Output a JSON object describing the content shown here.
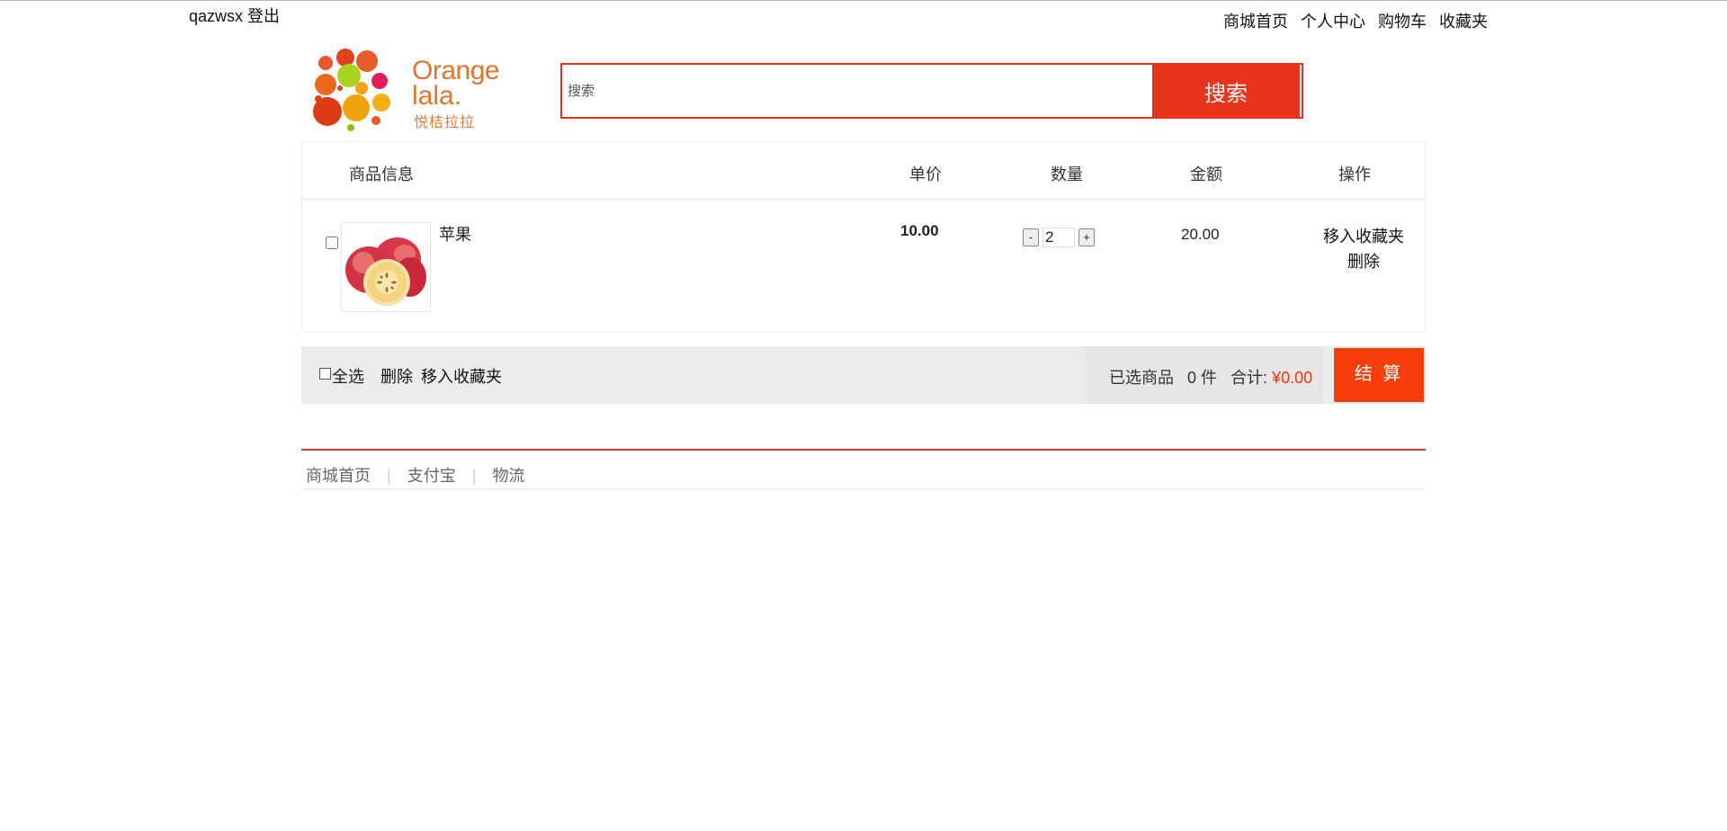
{
  "header": {
    "username": "qazwsx",
    "logout_label": "登出",
    "nav": [
      "商城首页",
      "个人中心",
      "购物车",
      "收藏夹"
    ]
  },
  "logo": {
    "line1": "Orange",
    "line2": "lala.",
    "line3": "悦桔拉拉"
  },
  "search": {
    "placeholder": "搜索",
    "button_label": "搜索",
    "accent_color": "#e8341c"
  },
  "cart": {
    "columns": {
      "info": "商品信息",
      "unit_price": "单价",
      "quantity": "数量",
      "amount": "金额",
      "operation": "操作"
    },
    "items": [
      {
        "name": "苹果",
        "price": "10.00",
        "quantity": "2",
        "amount": "20.00",
        "minus": "-",
        "plus": "+",
        "move_to_fav": "移入收藏夹",
        "delete": "删除",
        "image_icon": "apple-product-image"
      }
    ]
  },
  "summary": {
    "select_all": "全选",
    "delete": "删除",
    "move_to_fav": "移入收藏夹",
    "selected_label": "已选商品",
    "selected_count": "0",
    "count_unit": "件",
    "total_label": "合计:",
    "total_value": "¥0.00",
    "checkout_label": "结 算",
    "checkout_color": "#f53e0a"
  },
  "footer": {
    "links": [
      "商城首页",
      "支付宝",
      "物流"
    ]
  }
}
